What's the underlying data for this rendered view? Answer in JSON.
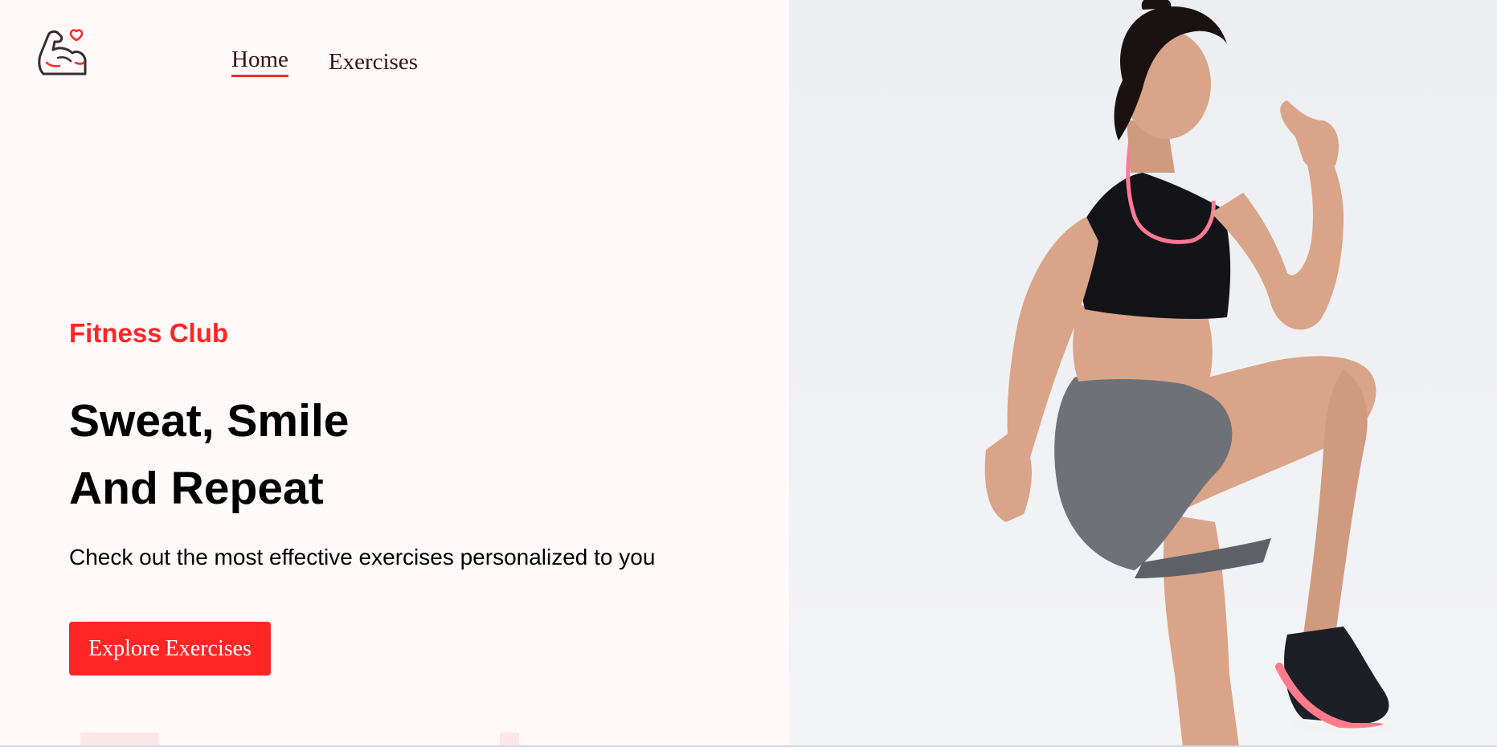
{
  "colors": {
    "accent": "#ff2625",
    "background": "#fff9fa",
    "nav_text": "#3a1212",
    "hero_bg": "#eceef2"
  },
  "header": {
    "logo_icon": "flexed-arm-heart-icon",
    "nav": [
      {
        "label": "Home",
        "active": true
      },
      {
        "label": "Exercises",
        "active": false
      }
    ]
  },
  "hero": {
    "kicker": "Fitness Club",
    "headline_line1": "Sweat, Smile",
    "headline_line2": "And Repeat",
    "tagline": "Check out the most effective exercises personalized to you",
    "cta_label": "Explore Exercises",
    "image_subject": "woman-exercising-knee-raise"
  }
}
